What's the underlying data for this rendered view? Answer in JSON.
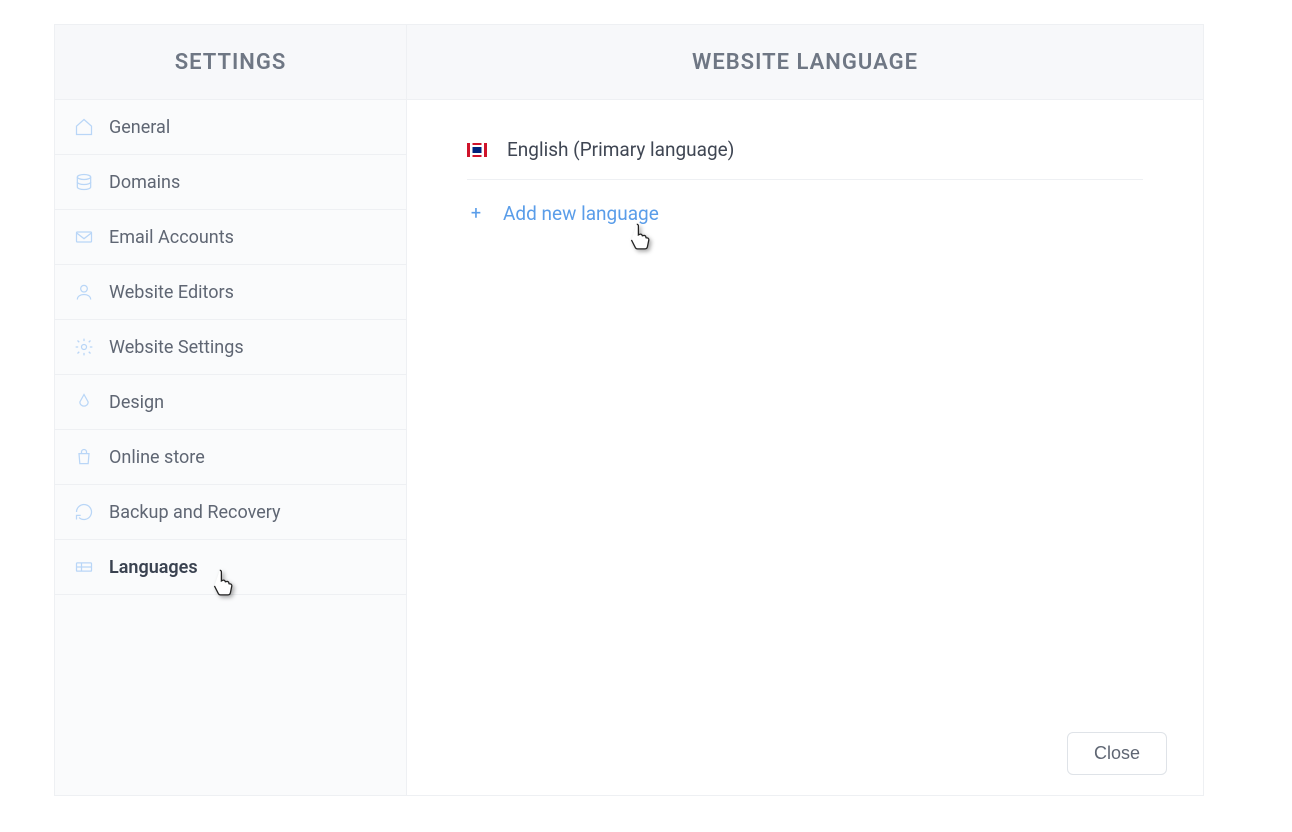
{
  "sidebar": {
    "title": "SETTINGS",
    "items": [
      {
        "label": "General",
        "icon": "home-icon"
      },
      {
        "label": "Domains",
        "icon": "database-icon"
      },
      {
        "label": "Email Accounts",
        "icon": "mail-icon"
      },
      {
        "label": "Website Editors",
        "icon": "user-icon"
      },
      {
        "label": "Website Settings",
        "icon": "gear-icon"
      },
      {
        "label": "Design",
        "icon": "paint-icon"
      },
      {
        "label": "Online store",
        "icon": "bag-icon"
      },
      {
        "label": "Backup and Recovery",
        "icon": "refresh-icon"
      },
      {
        "label": "Languages",
        "icon": "language-icon",
        "active": true
      }
    ]
  },
  "main": {
    "title": "WEBSITE LANGUAGE",
    "language": {
      "flag": "uk-flag",
      "label": "English (Primary language)"
    },
    "add_label": "Add new language",
    "close_label": "Close"
  }
}
